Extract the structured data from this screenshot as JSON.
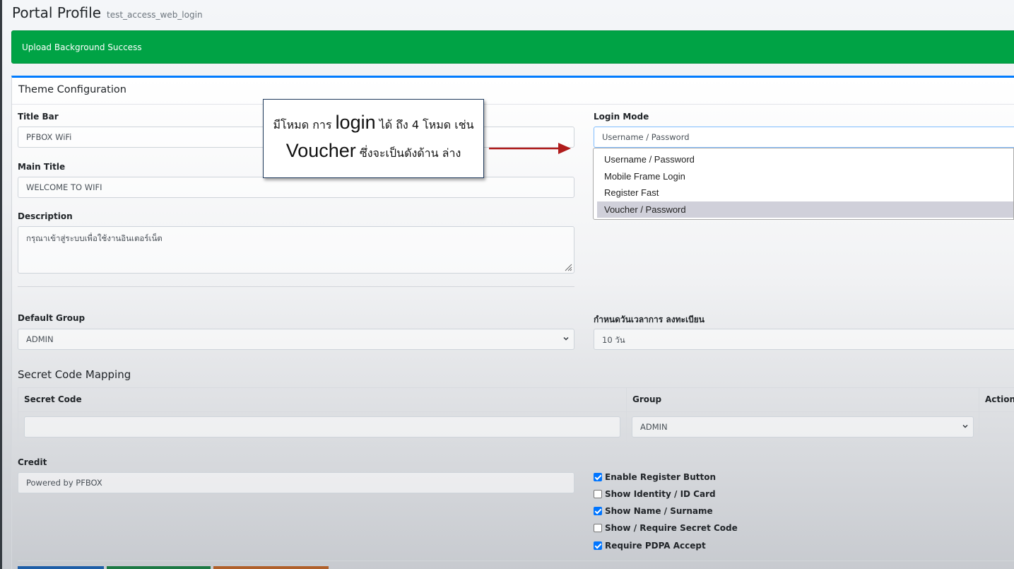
{
  "page": {
    "title": "Portal Profile",
    "subtitle": "test_access_web_login"
  },
  "alert": {
    "message": "Upload Background Success",
    "color": "#00a345"
  },
  "card": {
    "title": "Theme Configuration"
  },
  "form": {
    "title_bar": {
      "label": "Title Bar",
      "value": "PFBOX WiFi"
    },
    "main_title": {
      "label": "Main Title",
      "value": "WELCOME TO WIFI"
    },
    "description": {
      "label": "Description",
      "value": "กรุณาเข้าสู่ระบบเพื่อใช้งานอินเตอร์เน็ต"
    },
    "login_mode": {
      "label": "Login Mode",
      "value": "Username / Password",
      "options": [
        "Username / Password",
        "Mobile Frame Login",
        "Register Fast",
        "Voucher / Password"
      ],
      "highlighted": "Voucher / Password"
    },
    "default_group": {
      "label": "Default Group",
      "value": "ADMIN"
    },
    "register_period": {
      "label": "กำหนดวันเวลาการ ลงทะเบียน",
      "value": "10 วัน"
    },
    "credit": {
      "label": "Credit",
      "value": "Powered by PFBOX"
    }
  },
  "secret_code_mapping": {
    "title": "Secret Code Mapping",
    "columns": [
      "Secret Code",
      "Group",
      "Action"
    ],
    "row": {
      "secret_code": "",
      "group": "ADMIN"
    }
  },
  "options": [
    {
      "label": "Enable Register Button",
      "checked": true
    },
    {
      "label": "Show Identity / ID Card",
      "checked": false
    },
    {
      "label": "Show Name / Surname",
      "checked": true
    },
    {
      "label": "Show / Require Secret Code",
      "checked": false
    },
    {
      "label": "Require PDPA Accept",
      "checked": true
    }
  ],
  "callout": {
    "line1_a": "มีโหมด การ",
    "line1_b": "login",
    "line1_c": "ได้ ถึง 4 โหมด  เช่น",
    "line2_a": "Voucher",
    "line2_b": "ซึ่งจะเป็นดังด้าน ล่าง",
    "arrow_color": "#b01c1c"
  },
  "colors": {
    "primary": "#007bff",
    "success": "#00a345",
    "checkbox": "#0075ff"
  }
}
